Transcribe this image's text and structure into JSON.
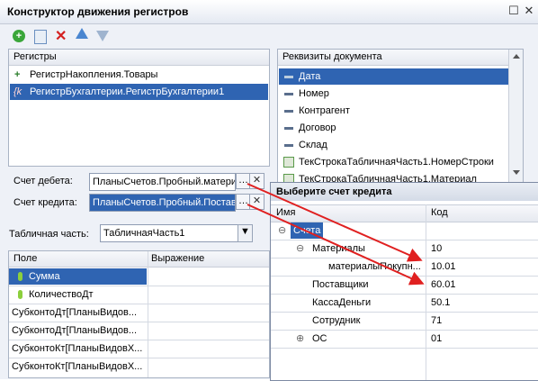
{
  "window": {
    "title": "Конструктор движения регистров"
  },
  "registers": {
    "header": "Регистры",
    "items": [
      {
        "label": "РегистрНакопления.Товары",
        "icon": "register-plus-icon",
        "selected": false
      },
      {
        "label": "РегистрБухгалтерии.РегистрБухгалтерии1",
        "icon": "accounting-register-icon",
        "selected": true
      }
    ]
  },
  "requisites": {
    "header": "Реквизиты документа",
    "items": [
      {
        "label": "Дата",
        "selected": true
      },
      {
        "label": "Номер",
        "selected": false
      },
      {
        "label": "Контрагент",
        "selected": false
      },
      {
        "label": "Договор",
        "selected": false
      },
      {
        "label": "Склад",
        "selected": false
      },
      {
        "label": "ТекСтрокаТабличнаяЧасть1.НомерСтроки",
        "selected": false
      },
      {
        "label": "ТекСтрокаТабличнаяЧасть1.Материал",
        "selected": false
      }
    ]
  },
  "debit": {
    "label": "Счет дебета:",
    "value": "ПланыСчетов.Пробный.матери"
  },
  "credit": {
    "label": "Счет кредита:",
    "value": "ПланыСчетов.Пробный.Постав"
  },
  "tabular": {
    "label": "Табличная часть:",
    "value": "ТабличнаяЧасть1"
  },
  "fields_table": {
    "col1": "Поле",
    "col2": "Выражение",
    "rows": [
      {
        "label": "Сумма",
        "selected": true
      },
      {
        "label": "КоличествоДт",
        "selected": false
      },
      {
        "label": "СубконтоДт[ПланыВидов...",
        "selected": false
      },
      {
        "label": "СубконтоДт[ПланыВидов...",
        "selected": false
      },
      {
        "label": "СубконтоКт[ПланыВидовХ...",
        "selected": false
      },
      {
        "label": "СубконтоКт[ПланыВидовХ...",
        "selected": false
      }
    ]
  },
  "popup": {
    "title": "Выберите счет кредита",
    "col1": "Имя",
    "col2": "Код",
    "rows": [
      {
        "name": "Счета",
        "code": ""
      },
      {
        "name": "Материалы",
        "code": "10"
      },
      {
        "name": "материалыПокупн...",
        "code": "10.01"
      },
      {
        "name": "Поставщики",
        "code": "60.01"
      },
      {
        "name": "КассаДеньги",
        "code": "50.1"
      },
      {
        "name": "Сотрудник",
        "code": "71"
      },
      {
        "name": "ОС",
        "code": "01"
      }
    ]
  },
  "colors": {
    "selection": "#2f64b2",
    "arrow": "#e02020"
  }
}
